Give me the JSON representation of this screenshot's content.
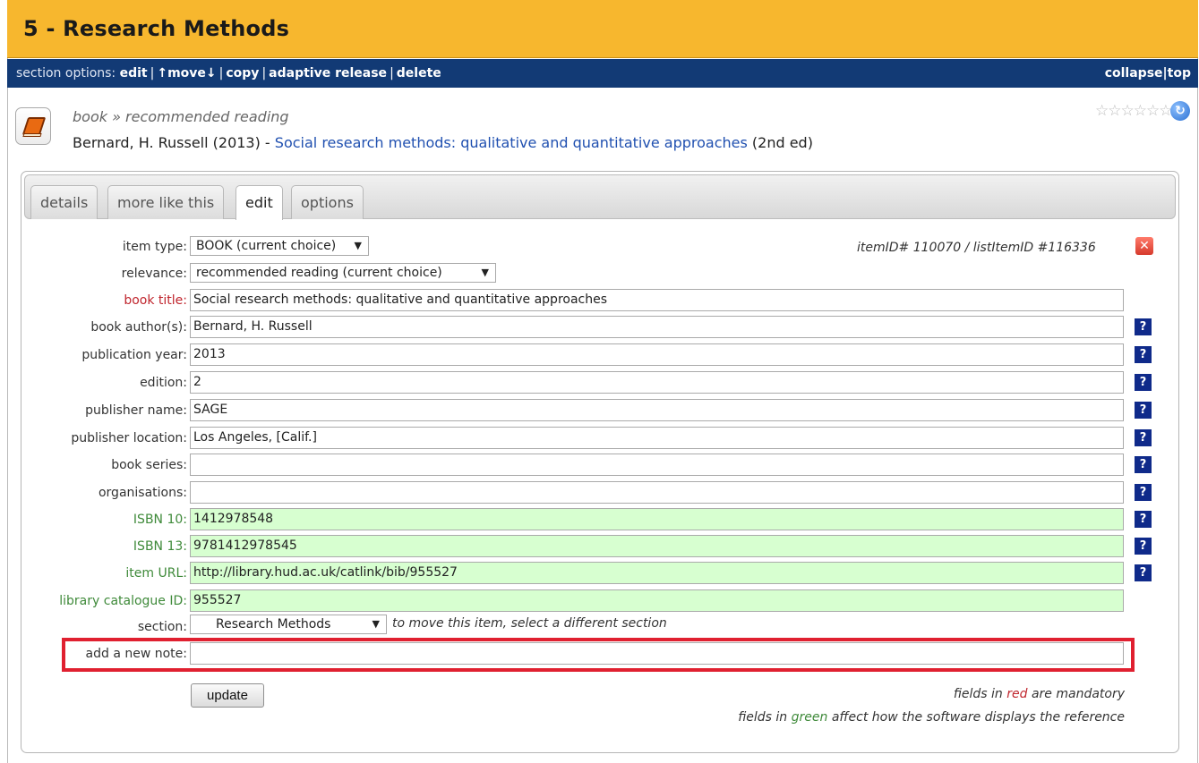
{
  "section": {
    "title": "5 - Research Methods"
  },
  "options_bar": {
    "label": "section options:",
    "links": [
      "edit",
      "↑move↓",
      "copy",
      "adaptive release",
      "delete"
    ],
    "right_links": [
      "collapse",
      "top"
    ]
  },
  "item": {
    "icon": "book-icon",
    "breadcrumb": "book » recommended reading",
    "citation_prefix": "Bernard, H. Russell (2013) - ",
    "citation_title": "Social research methods: qualitative and quantitative approaches",
    "citation_suffix": " (2nd ed)",
    "rating_stars": "☆☆☆☆☆☆",
    "rating_value": 0
  },
  "tabs": [
    {
      "label": "details",
      "active": false
    },
    {
      "label": "more like this",
      "active": false
    },
    {
      "label": "edit",
      "active": true
    },
    {
      "label": "options",
      "active": false
    }
  ],
  "form": {
    "item_type": {
      "label": "item type:",
      "value": "BOOK (current choice)"
    },
    "relevance": {
      "label": "relevance:",
      "value": "recommended reading (current choice)"
    },
    "item_ids": "itemID# 110070 / listItemID #116336",
    "fields": {
      "book_title": {
        "label": "book title:",
        "value": "Social research methods: qualitative and quantitative approaches"
      },
      "book_authors": {
        "label": "book author(s):",
        "value": "Bernard, H. Russell"
      },
      "publication_year": {
        "label": "publication year:",
        "value": "2013"
      },
      "edition": {
        "label": "edition:",
        "value": "2"
      },
      "publisher_name": {
        "label": "publisher name:",
        "value": "SAGE"
      },
      "publisher_location": {
        "label": "publisher location:",
        "value": "Los Angeles, [Calif.]"
      },
      "book_series": {
        "label": "book series:",
        "value": ""
      },
      "organisations": {
        "label": "organisations:",
        "value": ""
      },
      "isbn10": {
        "label": "ISBN 10:",
        "value": "1412978548"
      },
      "isbn13": {
        "label": "ISBN 13:",
        "value": "9781412978545"
      },
      "item_url": {
        "label": "item URL:",
        "value": "http://library.hud.ac.uk/catlink/bib/955527"
      },
      "catalogue_id": {
        "label": "library catalogue ID:",
        "value": "955527"
      }
    },
    "section_select": {
      "label": "section:",
      "value": "Research Methods",
      "hint": "to move this item, select a different section"
    },
    "new_note": {
      "label": "add a new note:",
      "value": ""
    },
    "help_label": "?",
    "update_label": "update",
    "legend_red": {
      "pre": "fields in ",
      "word": "red",
      "post": " are mandatory"
    },
    "legend_green": {
      "pre": "fields in ",
      "word": "green",
      "post": " affect how the software displays the reference"
    }
  },
  "colors": {
    "header_bg": "#f7b72e",
    "options_bg": "#123a75",
    "mandatory": "#c0262e",
    "display": "#3f8a3a",
    "green_input": "#d7ffd0",
    "help_bg": "#0f2a8a",
    "note_highlight": "#e02030"
  }
}
